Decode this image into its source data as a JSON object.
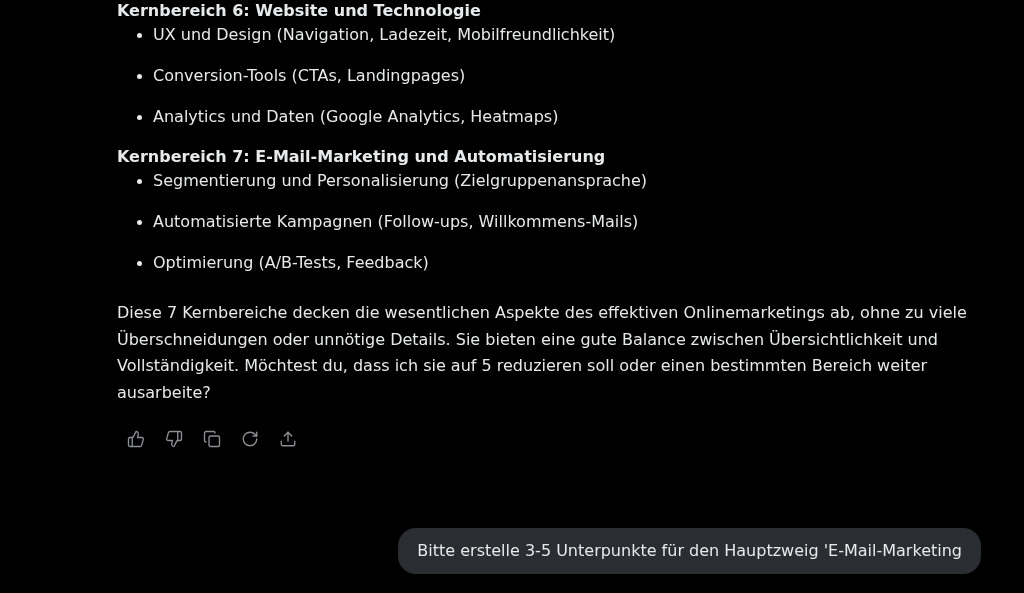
{
  "sections": [
    {
      "heading": "Kernbereich 6: Website und Technologie",
      "items": [
        "UX und Design (Navigation, Ladezeit, Mobilfreundlichkeit)",
        "Conversion-Tools (CTAs, Landingpages)",
        "Analytics und Daten (Google Analytics, Heatmaps)"
      ]
    },
    {
      "heading": "Kernbereich 7: E-Mail-Marketing und Automatisierung",
      "items": [
        "Segmentierung und Personalisierung (Zielgruppenansprache)",
        "Automatisierte Kampagnen (Follow-ups, Willkommens-Mails)",
        "Optimierung (A/B-Tests, Feedback)"
      ]
    }
  ],
  "summary": "Diese 7 Kernbereiche decken die wesentlichen Aspekte des effektiven Onlinemarketings ab, ohne zu viele Überschneidungen oder unnötige Details. Sie bieten eine gute Balance zwischen Übersichtlichkeit und Vollständigkeit. Möchtest du, dass ich sie auf 5 reduzieren soll oder einen bestimmten Bereich weiter ausarbeite?",
  "actions": [
    {
      "kind": "like"
    },
    {
      "kind": "dislike"
    },
    {
      "kind": "copy"
    },
    {
      "kind": "regenerate"
    },
    {
      "kind": "share"
    }
  ],
  "user_message": "Bitte erstelle 3-5 Unterpunkte für den Hauptzweig 'E-Mail-Marketing"
}
